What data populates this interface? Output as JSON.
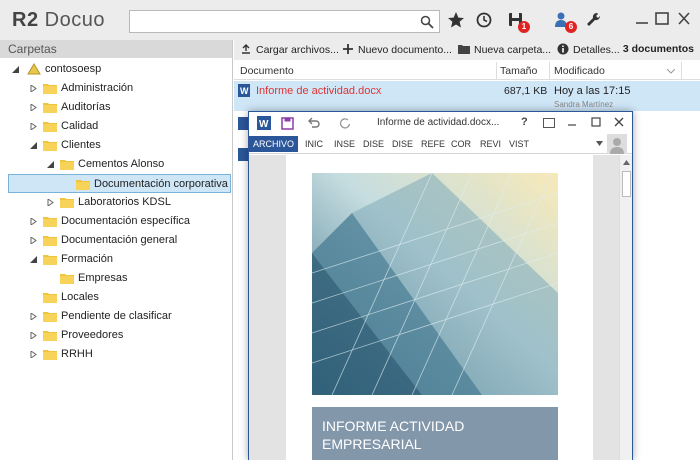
{
  "app": {
    "logo_bold": "R2",
    "logo_text": "Docuo",
    "search_placeholder": "",
    "notifications": {
      "documents_badge": "1",
      "users_badge": "6"
    },
    "accent": "#e02424"
  },
  "sidebar": {
    "title": "Carpetas",
    "items": [
      {
        "label": "contosoesp"
      },
      {
        "label": "Administración"
      },
      {
        "label": "Auditorías"
      },
      {
        "label": "Calidad"
      },
      {
        "label": "Clientes"
      },
      {
        "label": "Cementos Alonso"
      },
      {
        "label": "Documentación corporativa"
      },
      {
        "label": "Laboratorios KDSL"
      },
      {
        "label": "Documentación específica"
      },
      {
        "label": "Documentación general"
      },
      {
        "label": "Formación"
      },
      {
        "label": "Empresas"
      },
      {
        "label": "Locales"
      },
      {
        "label": "Pendiente de clasificar"
      },
      {
        "label": "Proveedores"
      },
      {
        "label": "RRHH"
      }
    ]
  },
  "toolbar": {
    "upload": "Cargar archivos...",
    "new_doc": "Nuevo documento...",
    "new_folder": "Nueva carpeta...",
    "details": "Detalles...",
    "count": "3 documentos"
  },
  "table": {
    "columns": [
      "Documento",
      "Tamaño",
      "Modificado"
    ],
    "rows": [
      {
        "name": "Informe de actividad.docx",
        "size": "687,1 KB",
        "modified": "Hoy a las 17:15",
        "user": "Sandra Martínez"
      }
    ]
  },
  "word": {
    "title": "Informe de actividad.docx...",
    "help": "?",
    "tabs": [
      "ARCHIVO",
      "INIC",
      "INSE",
      "DISE",
      "DISE",
      "REFE",
      "COR",
      "REVI",
      "VIST"
    ],
    "cover_title": "INFORME ACTIVIDAD EMPRESARIAL",
    "accent": "#2b579a"
  }
}
